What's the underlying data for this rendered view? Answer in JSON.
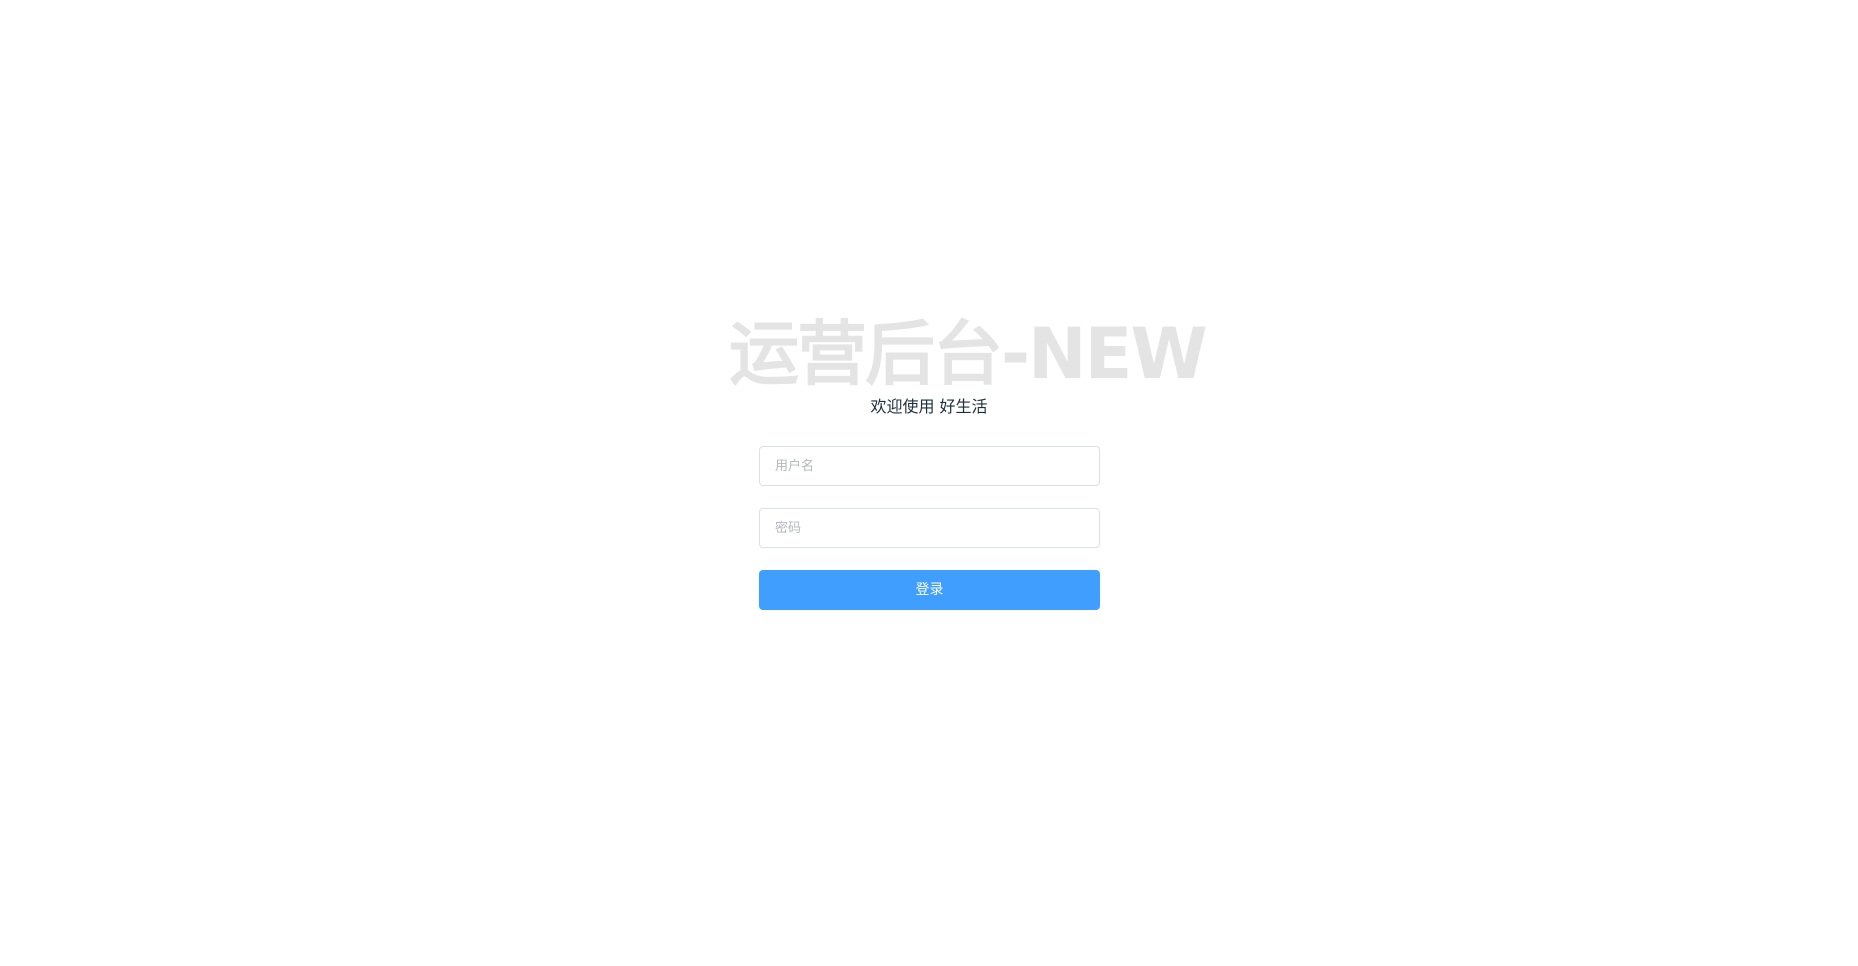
{
  "login": {
    "title": "运营后台-NEW",
    "welcome": "欢迎使用 好生活",
    "username_placeholder": "用户名",
    "password_placeholder": "密码",
    "submit_label": "登录"
  },
  "colors": {
    "primary": "#409eff",
    "title_watermark": "#e4e4e4",
    "welcome_text": "#1f2d3d",
    "input_border": "#dcdfe6",
    "placeholder": "#b4b7bd"
  }
}
